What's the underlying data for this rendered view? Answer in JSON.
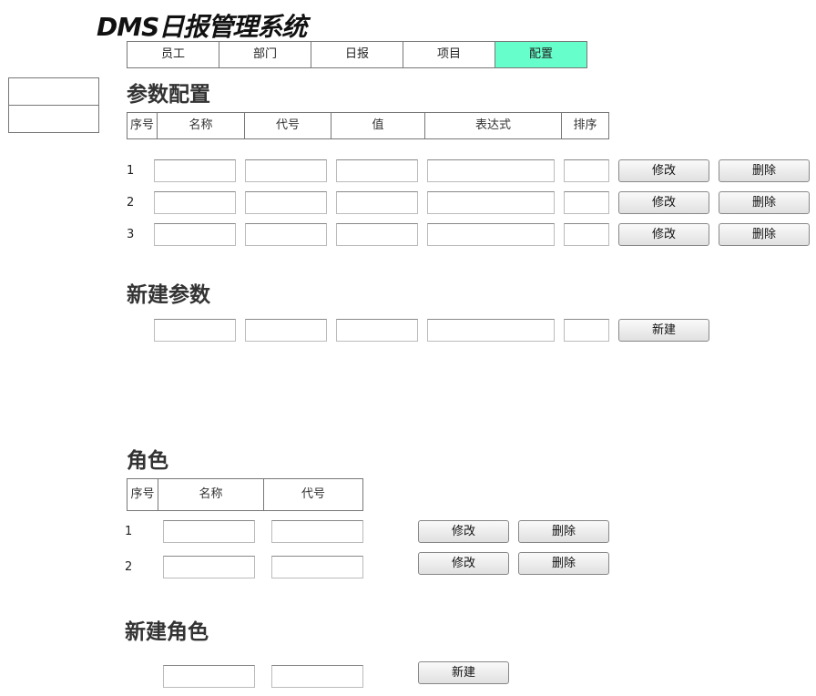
{
  "app": {
    "title": "DMS日报管理系统"
  },
  "nav": {
    "tabs": [
      {
        "label": "员工"
      },
      {
        "label": "部门"
      },
      {
        "label": "日报"
      },
      {
        "label": "项目"
      },
      {
        "label": "配置",
        "active": true
      }
    ],
    "active_color": "#66ffcc"
  },
  "params": {
    "title": "参数配置",
    "headers": [
      "序号",
      "名称",
      "代号",
      "值",
      "表达式",
      "排序"
    ],
    "rows": [
      {
        "index": "1",
        "edit_label": "修改",
        "delete_label": "删除"
      },
      {
        "index": "2",
        "edit_label": "修改",
        "delete_label": "删除"
      },
      {
        "index": "3",
        "edit_label": "修改",
        "delete_label": "删除"
      }
    ],
    "new_title": "新建参数",
    "create_label": "新建"
  },
  "roles": {
    "title": "角色",
    "headers": [
      "序号",
      "名称",
      "代号"
    ],
    "rows": [
      {
        "index": "1",
        "edit_label": "修改",
        "delete_label": "删除"
      },
      {
        "index": "2",
        "edit_label": "修改",
        "delete_label": "删除"
      }
    ],
    "new_title": "新建角色",
    "create_label": "新建"
  }
}
